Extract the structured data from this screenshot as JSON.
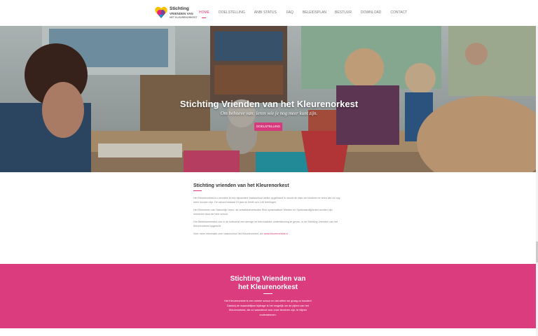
{
  "header": {
    "logo": {
      "line1": "Stichting",
      "line2": "VRIENDEN VAN",
      "line3": "HET KLEURENORKEST"
    },
    "nav": [
      {
        "label": "HOME",
        "active": true
      },
      {
        "label": "DOELSTELLING",
        "active": false
      },
      {
        "label": "ANBI STATUS",
        "active": false
      },
      {
        "label": "FAQ",
        "active": false
      },
      {
        "label": "BELEIDSPLAN",
        "active": false
      },
      {
        "label": "BESTUUR",
        "active": false
      },
      {
        "label": "DOWNLOAD",
        "active": false
      },
      {
        "label": "CONTACT",
        "active": false
      }
    ]
  },
  "hero": {
    "title": "Stichting Vrienden van het Kleurenorkest",
    "subtitle": "Om behoeve van: leren wie je nog meer kunt zijn.",
    "button": "DOELSTELLING"
  },
  "about": {
    "heading": "Stichting vrienden van het Kleurenorkest",
    "p1": "Het Kleurenorkest in Lemmers is een bijzondere basisschool welke opgebrand is vanuit de visie om kinderen te leren wie ze nog meer kunnen zijn. De school bestaat 10 jaar en heeft ca's 140 leerlingen.",
    "p2": "Het Stimuleren van Natuurlijk Leren, de ontwikkelmethodes Rich systematisch Werken en Spelsvaardigheden worden zijn verweven door de hele school.",
    "p3": "Om Beleidsmeesters ook in de toekomst een stevige en betrouwbare ondersteuning te geven, is de Stichting Vrienden van het Kleurenorkest opgericht.",
    "p4_text": "Voor meer informatie over basisschool het Kleurenorkest, zie",
    "p4_link": "www.kleurenorkest.nl"
  },
  "cta": {
    "title_line1": "Stichting Vrienden van",
    "title_line2": "het Kleurenorkest",
    "text": "Het Kleurenorkest is een unieke school en dat willen we graag zo houden! Dankzij de maandelijkse bijdrage is het mogelijk om de pijlers van het Kleurenorkest, die zo waardevol voor onze kinderen zijn, te blijven ondersteunen."
  },
  "colors": {
    "accent": "#d63a7d",
    "cta_bg": "#db3c7e"
  }
}
